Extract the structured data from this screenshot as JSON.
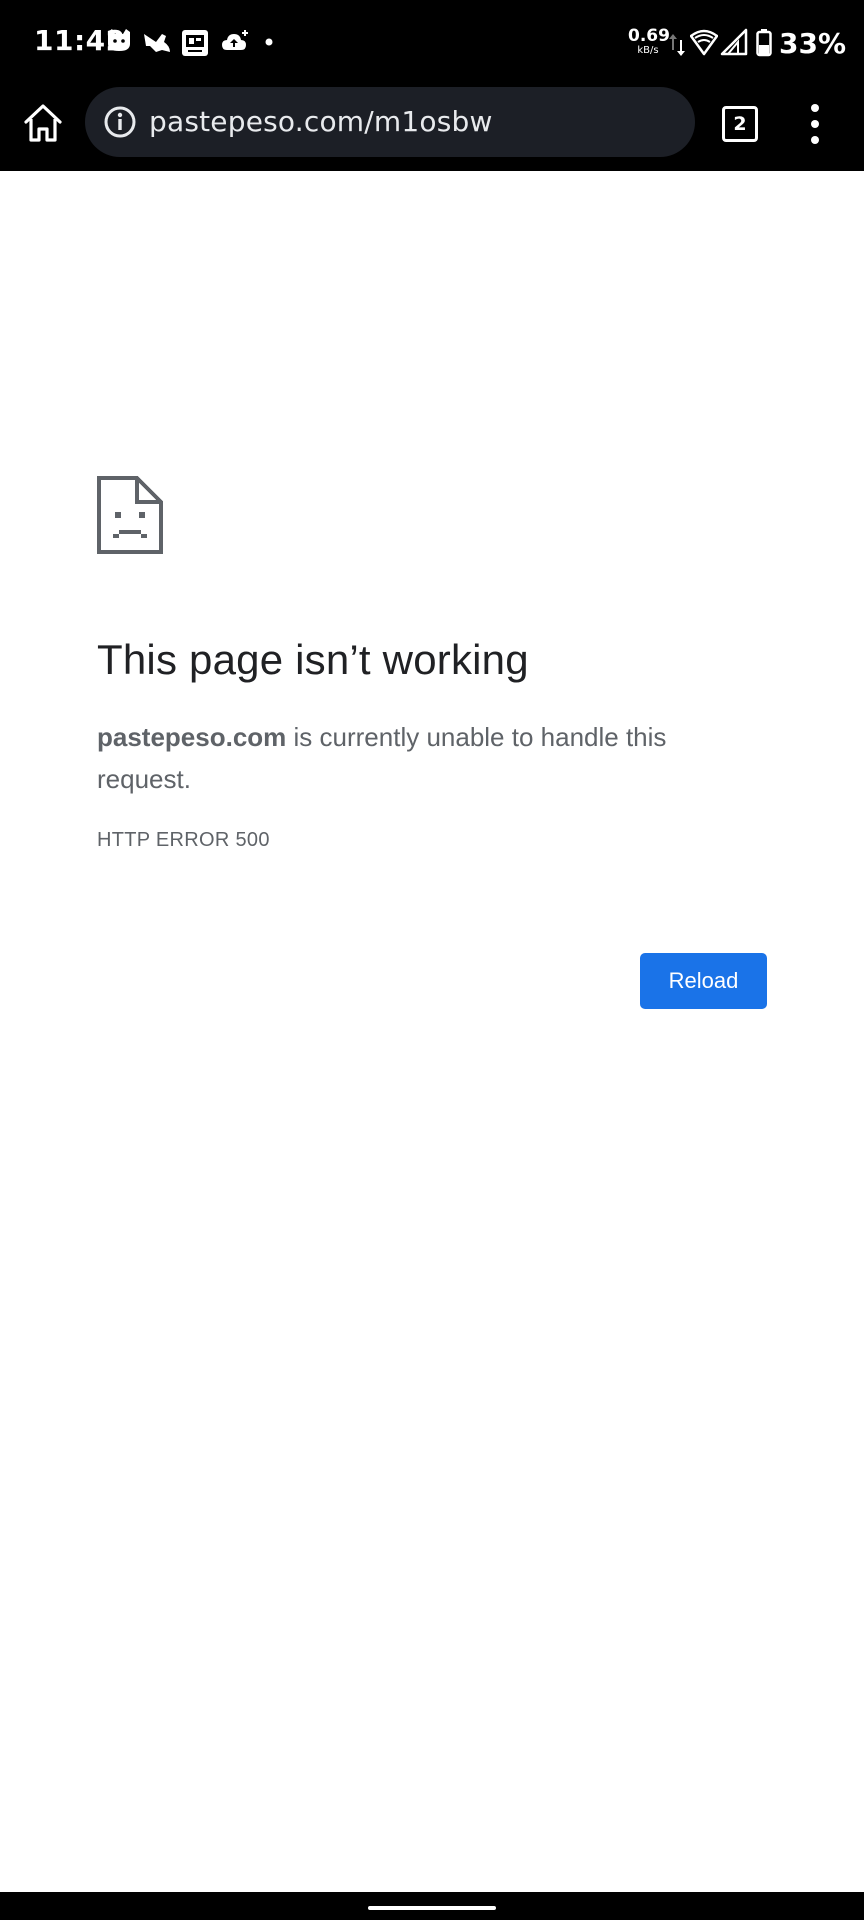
{
  "status_bar": {
    "time": "11:42",
    "notification_icons": [
      "cat-app-icon",
      "bird-app-icon",
      "screen-cast-icon",
      "cloud-upload-icon",
      "more-notifications-dot-icon"
    ],
    "net_speed_value": "0.69",
    "net_speed_unit": "kB/s",
    "battery_percent": "33%"
  },
  "toolbar": {
    "url": "pastepeso.com/m1osbw",
    "tab_count": "2"
  },
  "error_page": {
    "title": "This page isn’t working",
    "host": "pastepeso.com",
    "message": " is currently unable to handle this request.",
    "error_code": "HTTP ERROR 500",
    "reload_label": "Reload"
  },
  "colors": {
    "accent": "#1a73e8",
    "title_text": "#202124",
    "body_text": "#5f6368",
    "bar_background": "#000000",
    "omnibox_background": "#1c1f26"
  }
}
